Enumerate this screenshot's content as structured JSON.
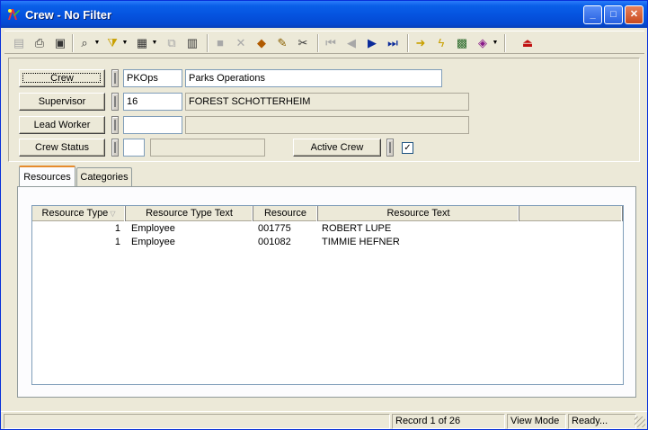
{
  "window": {
    "title": "Crew - No Filter"
  },
  "title_buttons": {
    "minimize": "_",
    "maximize": "□",
    "close": "✕"
  },
  "toolbar": {
    "icons": [
      "new-record-icon",
      "print-icon",
      "print-preview-icon",
      "search-icon",
      "filter-icon",
      "report-icon",
      "copy-icon",
      "paste-icon",
      "save-icon",
      "delete-icon",
      "attach-icon",
      "edit-icon",
      "cut-icon",
      "first-record-icon",
      "previous-record-icon",
      "next-record-icon",
      "last-record-icon",
      "goto-icon",
      "quick-icon",
      "map-icon",
      "help-book-icon",
      "exit-icon"
    ]
  },
  "form": {
    "crew": {
      "label": "Crew",
      "code": "PKOps",
      "name": "Parks Operations"
    },
    "supervisor": {
      "label": "Supervisor",
      "code": "16",
      "name": "FOREST SCHOTTERHEIM"
    },
    "lead_worker": {
      "label": "Lead Worker",
      "code": "",
      "name": ""
    },
    "crew_status": {
      "label": "Crew Status",
      "code": "",
      "name": ""
    },
    "active_crew": {
      "label": "Active Crew",
      "checked": "✓"
    }
  },
  "tabs": [
    {
      "label": "Resources"
    },
    {
      "label": "Categories"
    }
  ],
  "grid": {
    "columns": [
      "Resource Type",
      "Resource Type Text",
      "Resource",
      "Resource Text"
    ],
    "sort_icon": "▽",
    "rows": [
      {
        "resource_type": "1",
        "resource_type_text": "Employee",
        "resource": "001775",
        "resource_text": "ROBERT LUPE"
      },
      {
        "resource_type": "1",
        "resource_type_text": "Employee",
        "resource": "001082",
        "resource_text": "TIMMIE HEFNER"
      }
    ]
  },
  "status": {
    "record": "Record 1 of 26",
    "mode": "View Mode",
    "state": "Ready..."
  },
  "colors": {
    "title_bar": "#0554e0",
    "window_bg": "#ece9d8",
    "tab_highlight": "#e68b2c"
  }
}
